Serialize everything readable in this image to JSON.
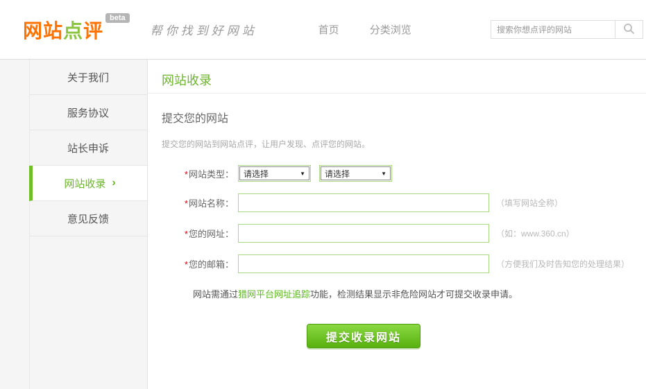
{
  "colors": {
    "brand_orange": "#ff7302",
    "brand_green": "#8bc53f",
    "accent_green": "#6cb52c",
    "link_green": "#5cb81e",
    "required_red": "#e60012",
    "input_border_green": "#a9d97e",
    "button_green_top": "#8ad943",
    "button_green_bottom": "#58b10e",
    "sidebar_bg": "#f5f5f5"
  },
  "header": {
    "logo": {
      "part1": "网站",
      "part2": "点",
      "part3": "评",
      "badge": "beta"
    },
    "tagline": "帮你找到好网站",
    "nav": [
      {
        "label": "首页"
      },
      {
        "label": "分类浏览"
      }
    ],
    "search": {
      "placeholder": "搜索你想点评的网站"
    }
  },
  "sidebar": {
    "items": [
      {
        "label": "关于我们"
      },
      {
        "label": "服务协议"
      },
      {
        "label": "站长申诉"
      },
      {
        "label": "网站收录",
        "arrow": "›"
      },
      {
        "label": "意见反馈"
      }
    ]
  },
  "main": {
    "page_title": "网站收录",
    "section_title": "提交您的网站",
    "section_desc": "提交您的网站到网站点评，让用户发现、点评您的网站。",
    "form": {
      "required_mark": "*",
      "type": {
        "label": "网站类型：",
        "select1_value": "请选择",
        "select2_value": "请选择",
        "arrow": "▼"
      },
      "name": {
        "label": "网站名称：",
        "hint": "（填写网站全称）"
      },
      "url": {
        "label": "您的网址：",
        "hint": "（如：www.360.cn）"
      },
      "email": {
        "label": "您的邮箱：",
        "hint": "（方便我们及时告知您的处理结果）"
      },
      "note": {
        "prefix": "网站需通过",
        "link": "猎网平台网址追踪",
        "suffix": "功能，检测结果显示非危险网站才可提交收录申请。"
      },
      "submit_label": "提交收录网站"
    }
  }
}
